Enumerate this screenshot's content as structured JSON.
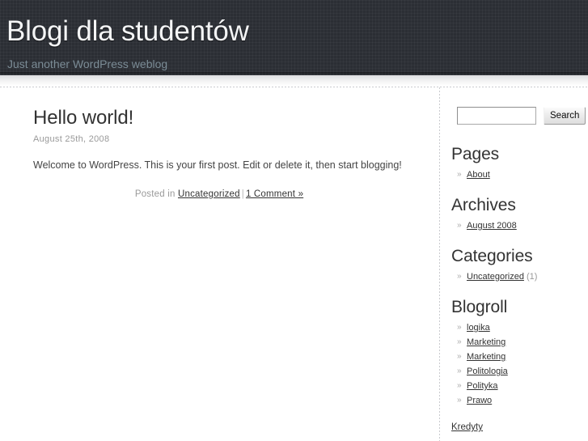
{
  "header": {
    "title": "Blogi dla studentów",
    "description": "Just another WordPress weblog"
  },
  "post": {
    "title": "Hello world!",
    "date": "August 25th, 2008",
    "body": "Welcome to WordPress. This is your first post. Edit or delete it, then start blogging!",
    "meta_prefix": "Posted in",
    "category_link": "Uncategorized",
    "separator": "|",
    "comments_link": "1 Comment »"
  },
  "search": {
    "value": "",
    "placeholder": "",
    "button_label": "Search"
  },
  "sidebar": {
    "bullet": "»",
    "widgets": [
      {
        "title": "Pages",
        "items": [
          {
            "label": "About",
            "count": ""
          }
        ]
      },
      {
        "title": "Archives",
        "items": [
          {
            "label": "August 2008",
            "count": ""
          }
        ]
      },
      {
        "title": "Categories",
        "items": [
          {
            "label": "Uncategorized",
            "count": "(1)"
          }
        ]
      },
      {
        "title": "Blogroll",
        "items": [
          {
            "label": "logika",
            "count": ""
          },
          {
            "label": "Marketing",
            "count": ""
          },
          {
            "label": "Marketing",
            "count": ""
          },
          {
            "label": "Politologia",
            "count": ""
          },
          {
            "label": "Polityka",
            "count": ""
          },
          {
            "label": "Prawo",
            "count": ""
          }
        ]
      }
    ],
    "extra_link": "Kredyty"
  },
  "colors": {
    "header_background": "#2b2e34",
    "title_text": "#f4f5f6",
    "tagline_text": "#7b8c96",
    "body_text": "#444444",
    "heading_text": "#333333",
    "muted_text": "#999999",
    "divider": "#c9cace"
  }
}
